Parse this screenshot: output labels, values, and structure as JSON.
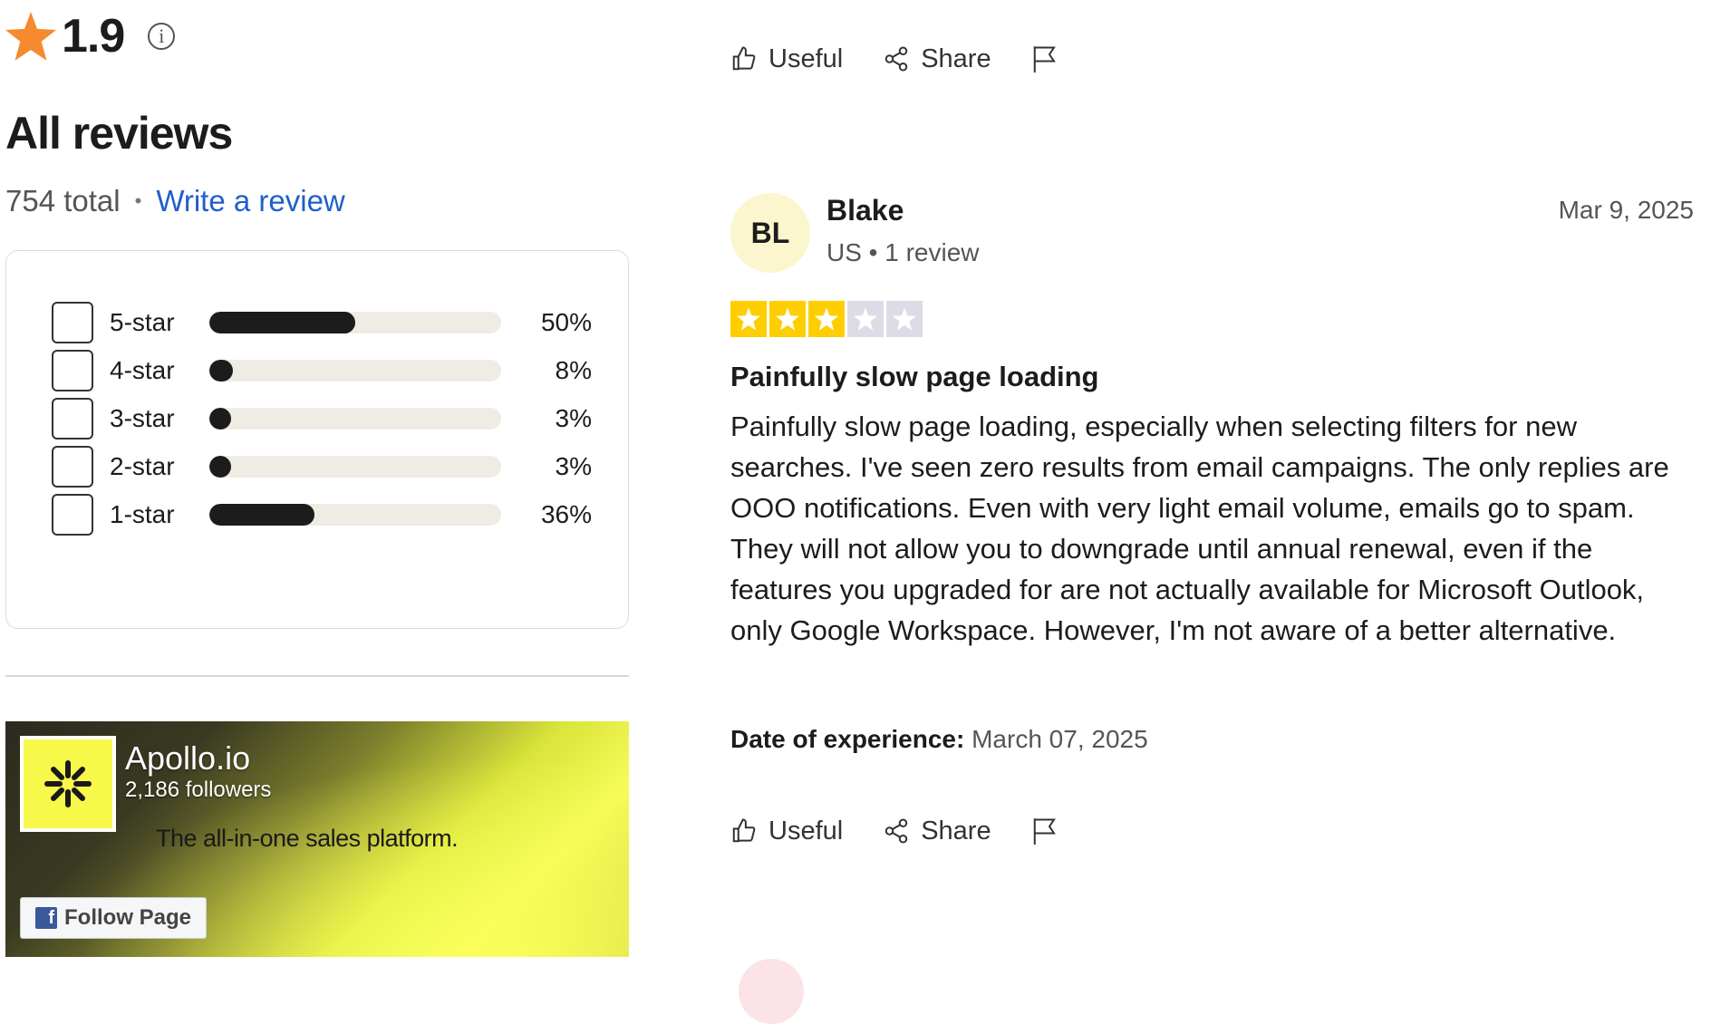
{
  "rating": {
    "value": "1.9",
    "info_icon": "info-icon",
    "star_color": "#f58a2e"
  },
  "reviews": {
    "heading": "All reviews",
    "total": "754 total",
    "write_link": "Write a review"
  },
  "distribution": [
    {
      "label": "5-star",
      "percent": "50%",
      "fraction": 0.5
    },
    {
      "label": "4-star",
      "percent": "8%",
      "fraction": 0.08
    },
    {
      "label": "3-star",
      "percent": "3%",
      "fraction": 0.03
    },
    {
      "label": "2-star",
      "percent": "3%",
      "fraction": 0.03
    },
    {
      "label": "1-star",
      "percent": "36%",
      "fraction": 0.36
    }
  ],
  "fb_widget": {
    "page_name": "Apollo.io",
    "followers": "2,186 followers",
    "tagline": "The all-in-one sales platform.",
    "follow_button": "Follow Page"
  },
  "actions": {
    "useful": "Useful",
    "share": "Share"
  },
  "review": {
    "initials": "BL",
    "name": "Blake",
    "meta": "US • 1 review",
    "date": "Mar 9, 2025",
    "stars": 3,
    "star_color": "#ffce00",
    "empty_star_color": "#dcdce6",
    "title": "Painfully slow page loading",
    "body": "Painfully slow page loading, especially when selecting filters for new searches. I've seen zero results from email campaigns. The only replies are OOO notifications. Even with very light email volume, emails go to spam. They will not allow you to downgrade until annual renewal, even if the features you upgraded for are not actually available for Microsoft Outlook, only Google Workspace. However, I'm not aware of a better alternative.",
    "experience_label": "Date of experience:",
    "experience_date": "March 07, 2025"
  }
}
